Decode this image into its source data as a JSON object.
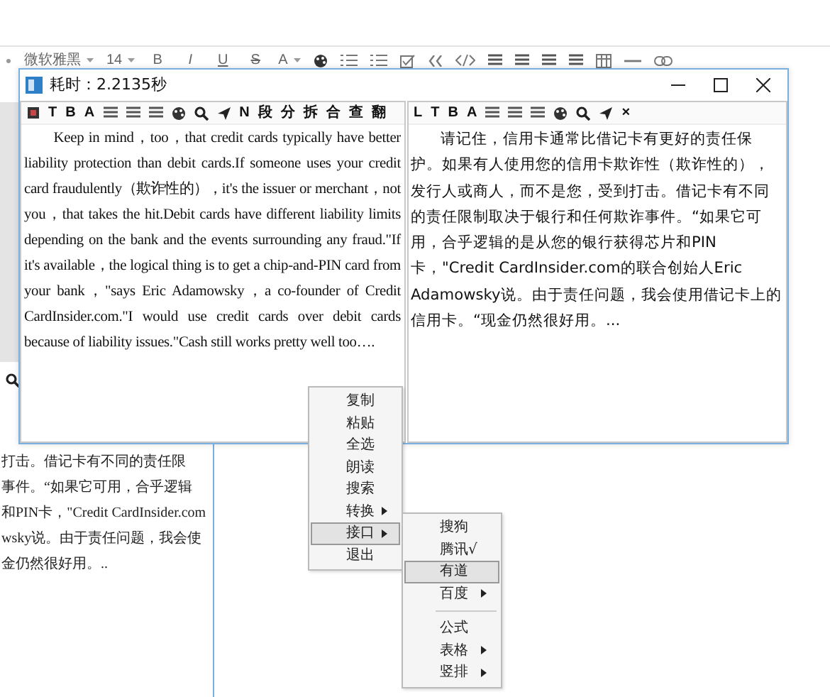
{
  "editor_toolbar": [
    {
      "kind": "dot"
    },
    {
      "kind": "dropdown",
      "label": "微软雅黑"
    },
    {
      "kind": "dropdown",
      "label": "14"
    },
    {
      "kind": "text",
      "label": "B"
    },
    {
      "kind": "italic",
      "label": "I"
    },
    {
      "kind": "underline",
      "label": "U"
    },
    {
      "kind": "strike",
      "label": "S"
    },
    {
      "kind": "dropdown",
      "label": "A"
    },
    {
      "kind": "palette"
    },
    {
      "kind": "list"
    },
    {
      "kind": "list"
    },
    {
      "kind": "checkbox"
    },
    {
      "kind": "quote"
    },
    {
      "kind": "code"
    },
    {
      "kind": "align"
    },
    {
      "kind": "align"
    },
    {
      "kind": "align"
    },
    {
      "kind": "align"
    },
    {
      "kind": "table"
    },
    {
      "kind": "rule"
    },
    {
      "kind": "link"
    }
  ],
  "popup": {
    "title": "耗时：2.2135秒",
    "left_toolbar": [
      {
        "kind": "square"
      },
      {
        "kind": "text",
        "label": "T"
      },
      {
        "kind": "text",
        "label": "B"
      },
      {
        "kind": "colortext",
        "label": "A"
      },
      {
        "kind": "align"
      },
      {
        "kind": "align"
      },
      {
        "kind": "align"
      },
      {
        "kind": "palette"
      },
      {
        "kind": "search"
      },
      {
        "kind": "send"
      },
      {
        "kind": "text",
        "label": "N"
      },
      {
        "kind": "text",
        "label": "段"
      },
      {
        "kind": "text",
        "label": "分"
      },
      {
        "kind": "text",
        "label": "拆"
      },
      {
        "kind": "text",
        "label": "合"
      },
      {
        "kind": "text",
        "label": "查"
      },
      {
        "kind": "text",
        "label": "翻"
      }
    ],
    "right_toolbar": [
      {
        "kind": "text",
        "label": "L"
      },
      {
        "kind": "text",
        "label": "T"
      },
      {
        "kind": "text",
        "label": "B"
      },
      {
        "kind": "colortext",
        "label": "A"
      },
      {
        "kind": "align"
      },
      {
        "kind": "align"
      },
      {
        "kind": "align"
      },
      {
        "kind": "palette"
      },
      {
        "kind": "search"
      },
      {
        "kind": "send"
      },
      {
        "kind": "text",
        "label": "×"
      }
    ],
    "left_text": "Keep in mind，too，that credit cards typically have better liability protection than debit cards.If someone uses your credit card fraudulently（欺诈性的），it's the issuer or merchant，not you，that takes the hit.Debit cards have different liability limits depending on the bank and the events surrounding any fraud.\"If it's available，the logical thing is to get a chip-and-PIN card from your bank，\"says Eric Adamowsky，a co-founder of Credit CardInsider.com.\"I would use credit cards over debit cards because of liability issues.\"Cash still works pretty well too….",
    "right_text": "请记住，信用卡通常比借记卡有更好的责任保护。如果有人使用您的信用卡欺诈性（欺诈性的），发行人或商人，而不是您，受到打击。借记卡有不同的责任限制取决于银行和任何欺诈事件。“如果它可用，合乎逻辑的是从您的银行获得芯片和PIN卡，\"Credit CardInsider.com的联合创始人Eric  Adamowsky说。由于责任问题，我会使用借记卡上的信用卡。“现金仍然很好用。..."
  },
  "background_document": {
    "lines": [
      "打击。借记卡有不同的责任限",
      "事件。“如果它可用，合乎逻辑",
      "和PIN卡，\"Credit CardInsider.com",
      "wsky说。由于责任问题，我会使",
      "金仍然很好用。.."
    ]
  },
  "context_menu": [
    {
      "label": "复制",
      "kind": "item",
      "selected": false
    },
    {
      "label": "粘贴",
      "kind": "item",
      "selected": false
    },
    {
      "label": "全选",
      "kind": "item",
      "selected": false
    },
    {
      "label": "朗读",
      "kind": "item",
      "selected": false
    },
    {
      "label": "搜索",
      "kind": "item",
      "selected": false
    },
    {
      "label": "转换",
      "kind": "submenu",
      "selected": false
    },
    {
      "label": "接口",
      "kind": "submenu",
      "selected": true
    },
    {
      "label": "退出",
      "kind": "item",
      "selected": false
    }
  ],
  "submenu": [
    {
      "label": "搜狗",
      "kind": "item",
      "selected": false
    },
    {
      "label": "腾讯√",
      "kind": "item",
      "selected": false
    },
    {
      "label": "有道",
      "kind": "item",
      "selected": true
    },
    {
      "label": "百度",
      "kind": "submenu",
      "selected": false
    },
    {
      "kind": "separator"
    },
    {
      "label": "公式",
      "kind": "item",
      "selected": false
    },
    {
      "label": "表格",
      "kind": "submenu",
      "selected": false
    },
    {
      "label": "竖排",
      "kind": "submenu",
      "selected": false
    }
  ]
}
